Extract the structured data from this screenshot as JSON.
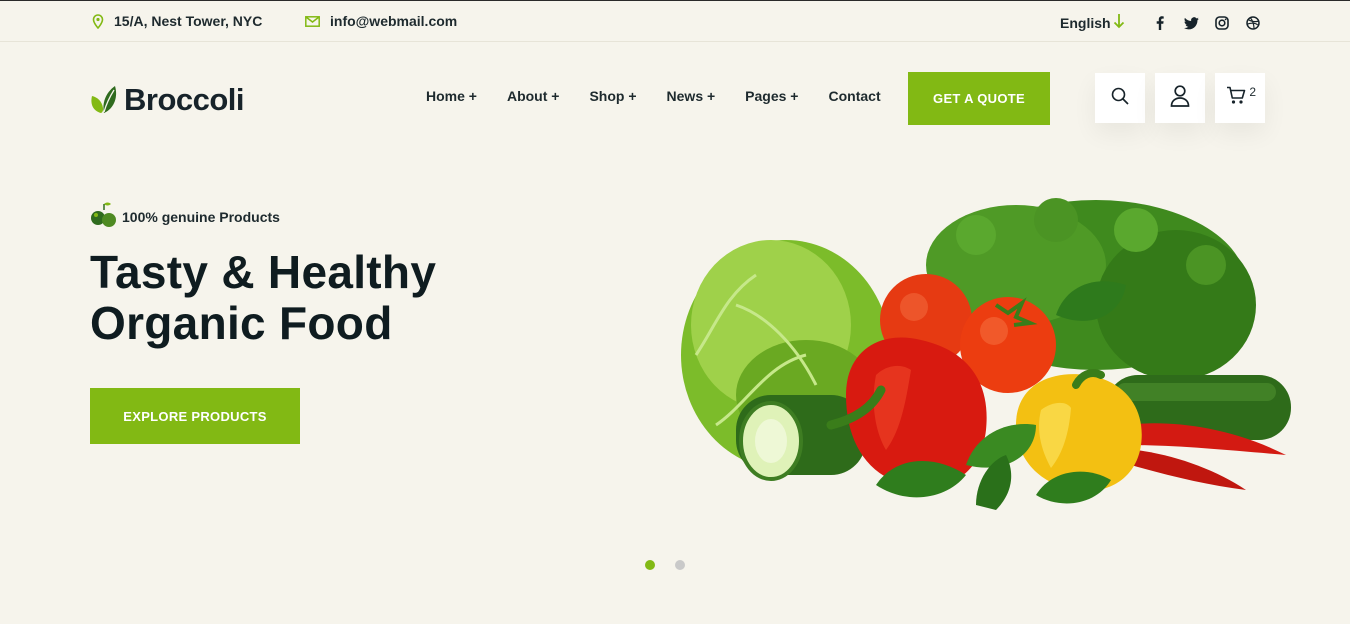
{
  "topbar": {
    "address": "15/A, Nest Tower, NYC",
    "email": "info@webmail.com",
    "language": "English",
    "socials": [
      "facebook-icon",
      "twitter-icon",
      "instagram-icon",
      "dribbble-icon"
    ]
  },
  "brand": {
    "name": "Broccoli",
    "accent": "#82b914"
  },
  "nav": {
    "items": [
      "Home +",
      "About +",
      "Shop +",
      "News +",
      "Pages +",
      "Contact"
    ]
  },
  "header": {
    "cta_label": "GET A QUOTE",
    "cart_count": "2"
  },
  "hero": {
    "tagline": "100% genuine Products",
    "title_line1": "Tasty & Healthy",
    "title_line2": "Organic Food",
    "button_label": "EXPLORE PRODUCTS",
    "slides": 2,
    "active_slide": 1
  }
}
